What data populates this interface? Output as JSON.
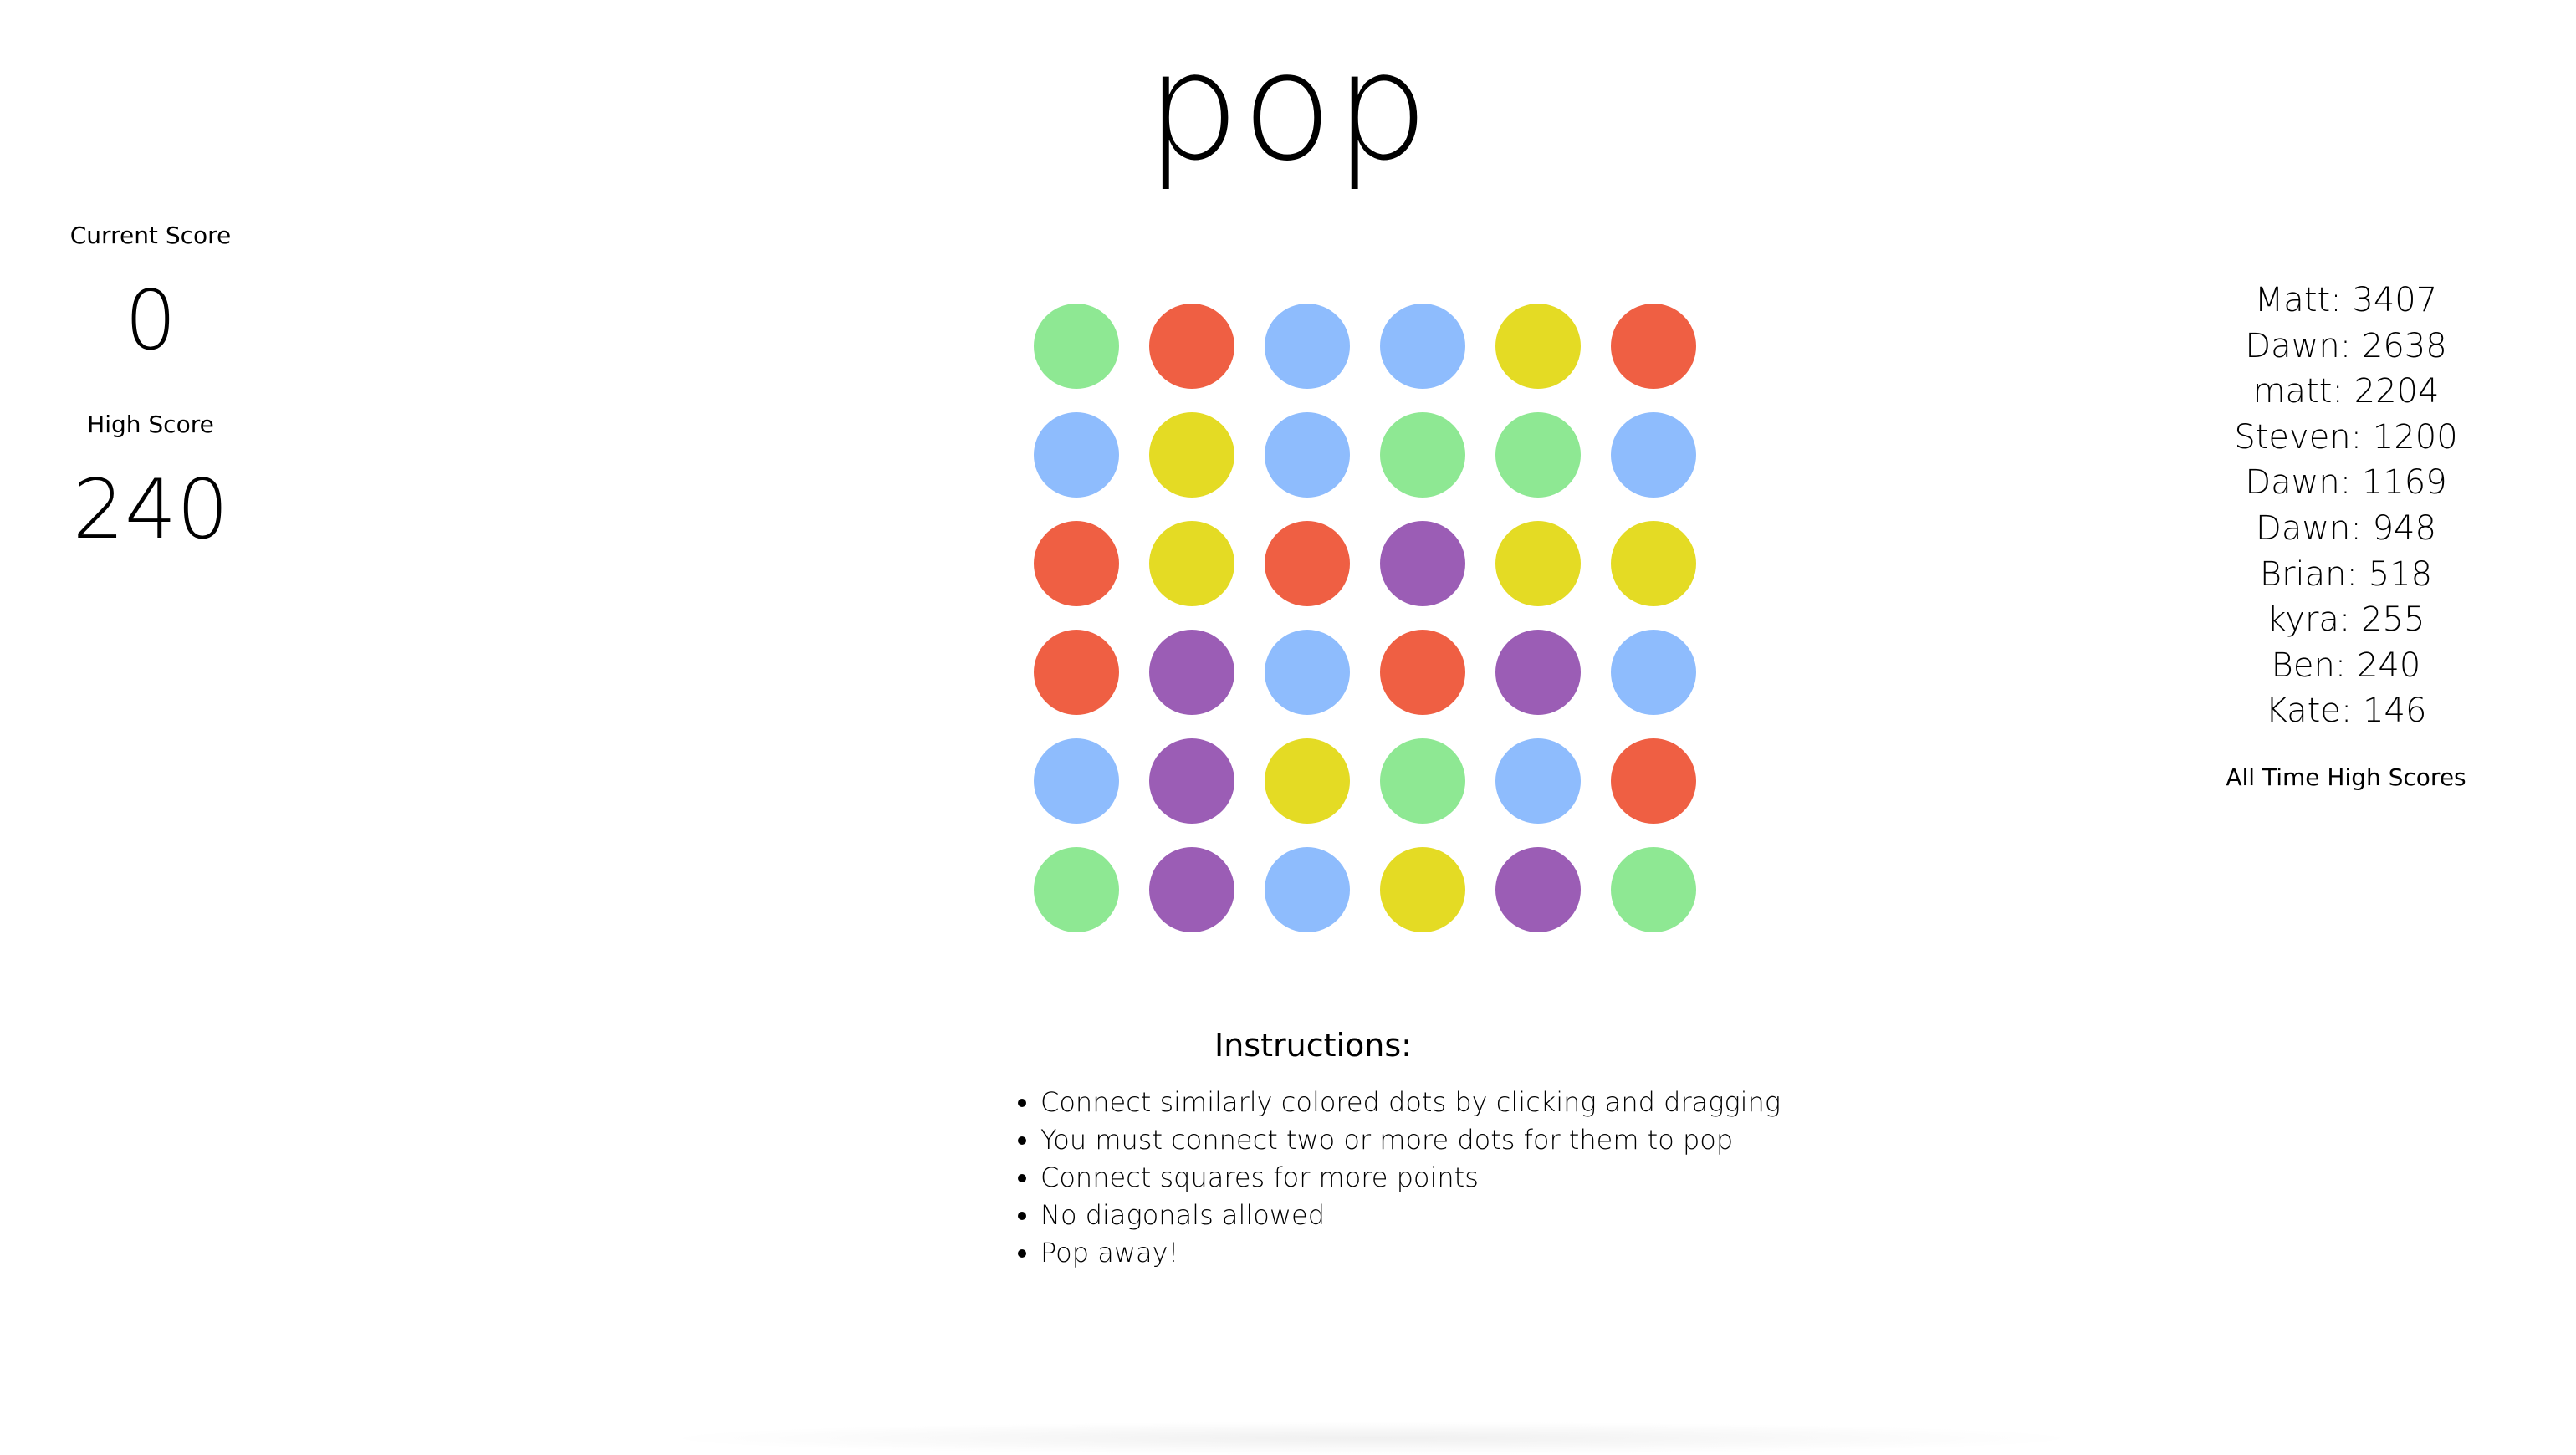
{
  "title": "pop",
  "scores": {
    "current_label": "Current Score",
    "current_value": "0",
    "high_label": "High Score",
    "high_value": "240"
  },
  "colors": {
    "green": "#8ee893",
    "red": "#ef5f43",
    "blue": "#8ebcfd",
    "yellow": "#e4db24",
    "purple": "#9b5db5"
  },
  "board": [
    [
      "green",
      "red",
      "blue",
      "blue",
      "yellow",
      "red"
    ],
    [
      "blue",
      "yellow",
      "blue",
      "green",
      "green",
      "blue"
    ],
    [
      "red",
      "yellow",
      "red",
      "purple",
      "yellow",
      "yellow"
    ],
    [
      "red",
      "purple",
      "blue",
      "red",
      "purple",
      "blue"
    ],
    [
      "blue",
      "purple",
      "yellow",
      "green",
      "blue",
      "red"
    ],
    [
      "green",
      "purple",
      "blue",
      "yellow",
      "purple",
      "green"
    ]
  ],
  "leaderboard": {
    "entries": [
      "Matt: 3407",
      "Dawn: 2638",
      "matt: 2204",
      "Steven: 1200",
      "Dawn: 1169",
      "Dawn: 948",
      "Brian: 518",
      "kyra: 255",
      "Ben: 240",
      "Kate: 146"
    ],
    "caption": "All Time High Scores"
  },
  "instructions": {
    "heading": "Instructions:",
    "items": [
      "Connect similarly colored dots by clicking and dragging",
      "You must connect two or more dots for them to pop",
      "Connect squares for more points",
      "No diagonals allowed",
      "Pop away!"
    ]
  }
}
